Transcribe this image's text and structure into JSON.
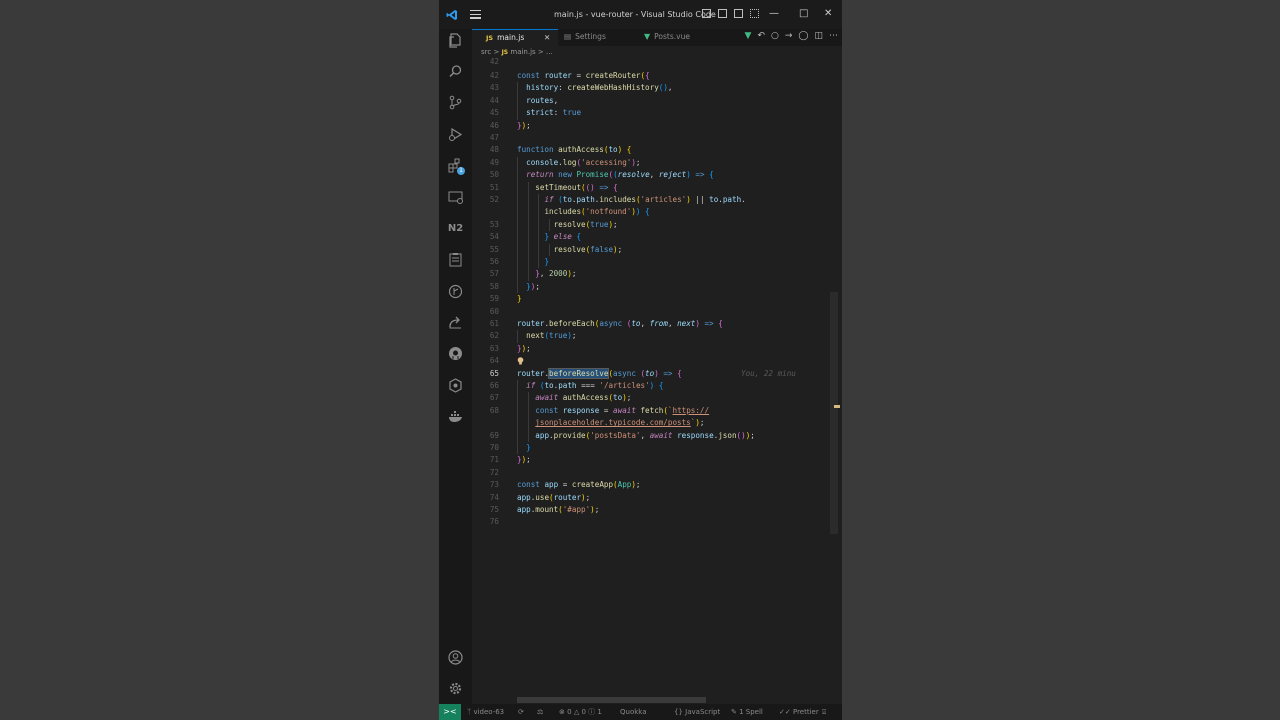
{
  "titlebar": {
    "title": "main.js - vue-router - Visual Studio Code",
    "minimize": "—",
    "maximize": "□",
    "close": "✕"
  },
  "tabs": [
    {
      "label": "main.js",
      "type": "JS",
      "active": true,
      "close": "✕"
    },
    {
      "label": "Settings",
      "type": "settings",
      "active": false
    },
    {
      "label": "Posts.vue",
      "type": "vue",
      "active": false
    }
  ],
  "breadcrumb": {
    "folder": "src",
    "sep": ">",
    "file_type": "JS",
    "file": "main.js",
    "more": "..."
  },
  "editor": {
    "current_line": 65,
    "blame": "You, 22 minu",
    "lines": [
      {
        "n": "42"
      },
      {
        "n": "43"
      },
      {
        "n": "44"
      },
      {
        "n": "45"
      },
      {
        "n": "46"
      },
      {
        "n": "47"
      },
      {
        "n": "48"
      },
      {
        "n": "49"
      },
      {
        "n": "50"
      },
      {
        "n": "51"
      },
      {
        "n": "52"
      },
      {
        "n": ""
      },
      {
        "n": "53"
      },
      {
        "n": "54"
      },
      {
        "n": "55"
      },
      {
        "n": "56"
      },
      {
        "n": "57"
      },
      {
        "n": "58"
      },
      {
        "n": "59"
      },
      {
        "n": "60"
      },
      {
        "n": "61"
      },
      {
        "n": "62"
      },
      {
        "n": "63"
      },
      {
        "n": "64"
      },
      {
        "n": "65"
      },
      {
        "n": "66"
      },
      {
        "n": "67"
      },
      {
        "n": "68"
      },
      {
        "n": ""
      },
      {
        "n": "69"
      },
      {
        "n": "70"
      },
      {
        "n": "71"
      },
      {
        "n": "72"
      },
      {
        "n": "73"
      },
      {
        "n": "74"
      },
      {
        "n": "75"
      },
      {
        "n": "76"
      }
    ],
    "tokens": {
      "t0": "const",
      "t1": "router",
      "t2": "=",
      "t3": "createRouter",
      "t4": "(",
      "t5": "{",
      "t6": "history",
      "t7": ":",
      "t8": "createWebHashHistory",
      "t9": "()",
      ",": ",",
      "t10": "routes",
      "t11": "strict",
      "t12": "true",
      "t13": "}",
      "t14": ")",
      ";": ";",
      "t15": "function",
      "t16": "authAccess",
      "t17": "to",
      "t18": "console",
      "t19": ".",
      "t20": "log",
      "t21": "'accessing'",
      "t22": "return",
      "t23": "new",
      "t24": "Promise",
      "t25": "resolve",
      "t26": "reject",
      "t27": "=>",
      "t28": "setTimeout",
      "t29": "if",
      "t30": "path",
      "t31": "includes",
      "t32": "'articles'",
      "t33": "||",
      "t34": "'notfound'",
      "t35": "else",
      "t36": "false",
      "t37": "2000",
      "t38": "beforeEach",
      "t39": "async",
      "t40": "from",
      "t41": "next",
      "t42": "beforeResolve",
      "t43": "===",
      "t44": "'/articles'",
      "t45": "await",
      "t46": "response",
      "t47": "fetch",
      "t48": "`",
      "t49": "https://",
      "t50": "jsonplaceholder.typicode.com/posts",
      "t51": "app",
      "t52": "provide",
      "t53": "'postsData'",
      "t54": "json",
      "t55": "createApp",
      "t56": "App",
      "t57": "use",
      "t58": "mount",
      "t59": "'#app'"
    }
  },
  "statusbar": {
    "remote": "><",
    "branch": "video-63",
    "errors": "0",
    "warnings": "0",
    "info": "1",
    "quokka": "Quokka",
    "language": "JavaScript",
    "spell": "1 Spell",
    "prettier": "Prettier"
  }
}
